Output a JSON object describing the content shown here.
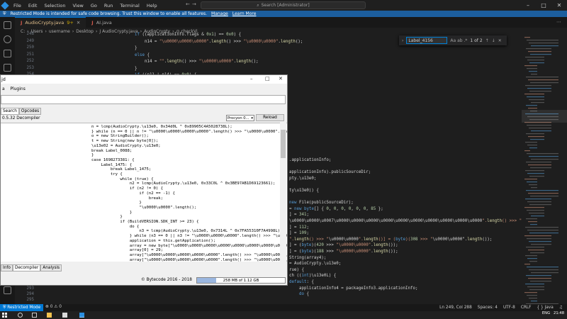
{
  "titlebar": {
    "menu": [
      "File",
      "Edit",
      "Selection",
      "View",
      "Go",
      "Run",
      "Terminal",
      "Help"
    ],
    "search_placeholder": "Search [Administrator]"
  },
  "banner": {
    "text": "Restricted Mode is intended for safe code browsing. Trust this window to enable all features.",
    "manage": "Manage",
    "learn_more": "Learn More"
  },
  "tabs": [
    {
      "label": "AudioCrypty.java",
      "badge": "9+",
      "active": true
    },
    {
      "label": "AI.java",
      "badge": "",
      "active": false
    }
  ],
  "breadcrumb": [
    "C:",
    "Users",
    "username",
    "Desktop",
    "J AudioCrypty.java",
    "AudioCrypty",
    "⊙ checkVi"
  ],
  "find": {
    "value": "Label_4156",
    "options": "Aa  ab  .*",
    "result": "1 of 2"
  },
  "editor_lines": [
    {
      "n": "248",
      "text": "if ((applicationInfo.flags & 0x1) == 0x0) {"
    },
    {
      "n": "249",
      "text": "    n14 = \"\\u0000\\u0000\\u0000\".length() >>> \"\\u0000\\u0000\".length();"
    },
    {
      "n": "250",
      "text": "}"
    },
    {
      "n": "251",
      "text": "else {"
    },
    {
      "n": "252",
      "text": "    n14 = \"\".length() >>> \"\\u0000\\u0000\".length();"
    },
    {
      "n": "253",
      "text": "}"
    },
    {
      "n": "254",
      "text": "if ((n11 | n14) == 0x0) {"
    }
  ],
  "editor_right_lines": [
    ".applicationInfo;",
    "",
    "applicationInfo).publicSourceDir;",
    "pty.\\u13e0;",
    "",
    "ty\\u13e0)) {",
    "",
    "new File(publicSourceDir);",
    "= new byte[] { 0, 0, 0, 0, 0, 0, 85 };",
    "] = 341;",
    "\\u0000\\u0000\\u0007\\u0000\\u0000\\u0000\\u0000\\u0000\\u0000\\u0000\\u0000\\u0000\\u0000\".length() >>> \"\\u0000\\u0000\".len",
    "] = 112;",
    "] = 109;",
    "\".length() >>> \"\\u0000\\u0000\".length()] = (byte)(308 >>> \"\\u0000\\u0000\".length());",
    "] = (byte)(420 >>> \"\\u0000\\u0000\".length());",
    "] = (byte)(188 >>> \"\\u0000\\u0000\".length());",
    "String(array4);",
    "= AudioCrypty.\\u13e0;",
    "rue) {",
    "ch ((int)\\u13e0L) {",
    "default: {",
    "    applicationInfo4 = packageInfo3.applicationInfo;",
    "    do {"
  ],
  "editor_bottom_lines": [
    "293",
    "294",
    "295"
  ],
  "decompiler": {
    "title": "jd",
    "menu": "Plugins",
    "subtabs": [
      "Search",
      "Opcodes"
    ],
    "info": "0.5.32 Decompiler",
    "select": "Procyon 0...",
    "reload": "Reload",
    "code_lines": [
      "n = lcmp(AudioCrypty.\\u13e0, 0x34d0L ^ 0x89905C4A5028738L);",
      "} while (n == 0 || n != \"\\u0000\\u0000\\u0000\\u0000\".length() >>> \"\\u0000\\u0000\".length",
      "o = new StringBuilder();",
      "t = new String(new byte[0]);",
      "\\u13e02 = AudioCrypty.\\u13e0;",
      "break Label_0088;",
      "}",
      "case 1698273381: {",
      "    Label_1475: {",
      "        break Label_1475;",
      "        try {",
      "            while (true) {",
      "                n2 = lcmp(AudioCrypty.\\u13e0, 0x33C0L ^ 0x3BE97AB1D69123661);",
      "                if (n2 != 0) {",
      "                    if (n2 == -1) {",
      "                        break;",
      "                    }",
      "                    \"\\u0000\\u0000\".length();",
      "                }",
      "            }",
      "            if (BuildVERSION.SDK_INT >= 23) {",
      "                do {",
      "                    n3 = lcmp(AudioCrypty.\\u13e0, 0x7314L ^ 0x7FA55310F7A4998L);",
      "                } while (n3 == 0 || n3 != \"\\u0000\\u0000\\u0000\".length() >>> \"\\u0000\\",
      "                application = this.getApplication();",
      "                array = new byte[\"\\u0000\\u0000\\u0000\\u0000\\u0000\\u0000\\u0000\\u0000\\",
      "                array[0] = 29;",
      "                array[\"\\u0000\\u0000\\u0000\\u0000\\u0000\".length() >>> \"\\u0000\\u0000\\",
      "                array[\"\\u0000\\u0000\\u0000\\u0000\\u0000\".length() >>> \"\\u0000\\u0000\\"
    ],
    "bottom_tabs": [
      "Info",
      "Decompiler",
      "Analysis"
    ],
    "copyright": "© Bytecode 2016 - 2018",
    "memory_text": "258 MB of 1.12 GB",
    "memory_fraction": 0.22
  },
  "statusbar": {
    "mode": "Restricted Mode",
    "ln_col": "Ln 249, Col 288",
    "spaces": "Spaces: 4",
    "encoding": "UTF-8",
    "eol": "CRLF",
    "lang": "{ } Java"
  },
  "taskbar": {
    "lang": "ENG",
    "time": "21:48"
  }
}
